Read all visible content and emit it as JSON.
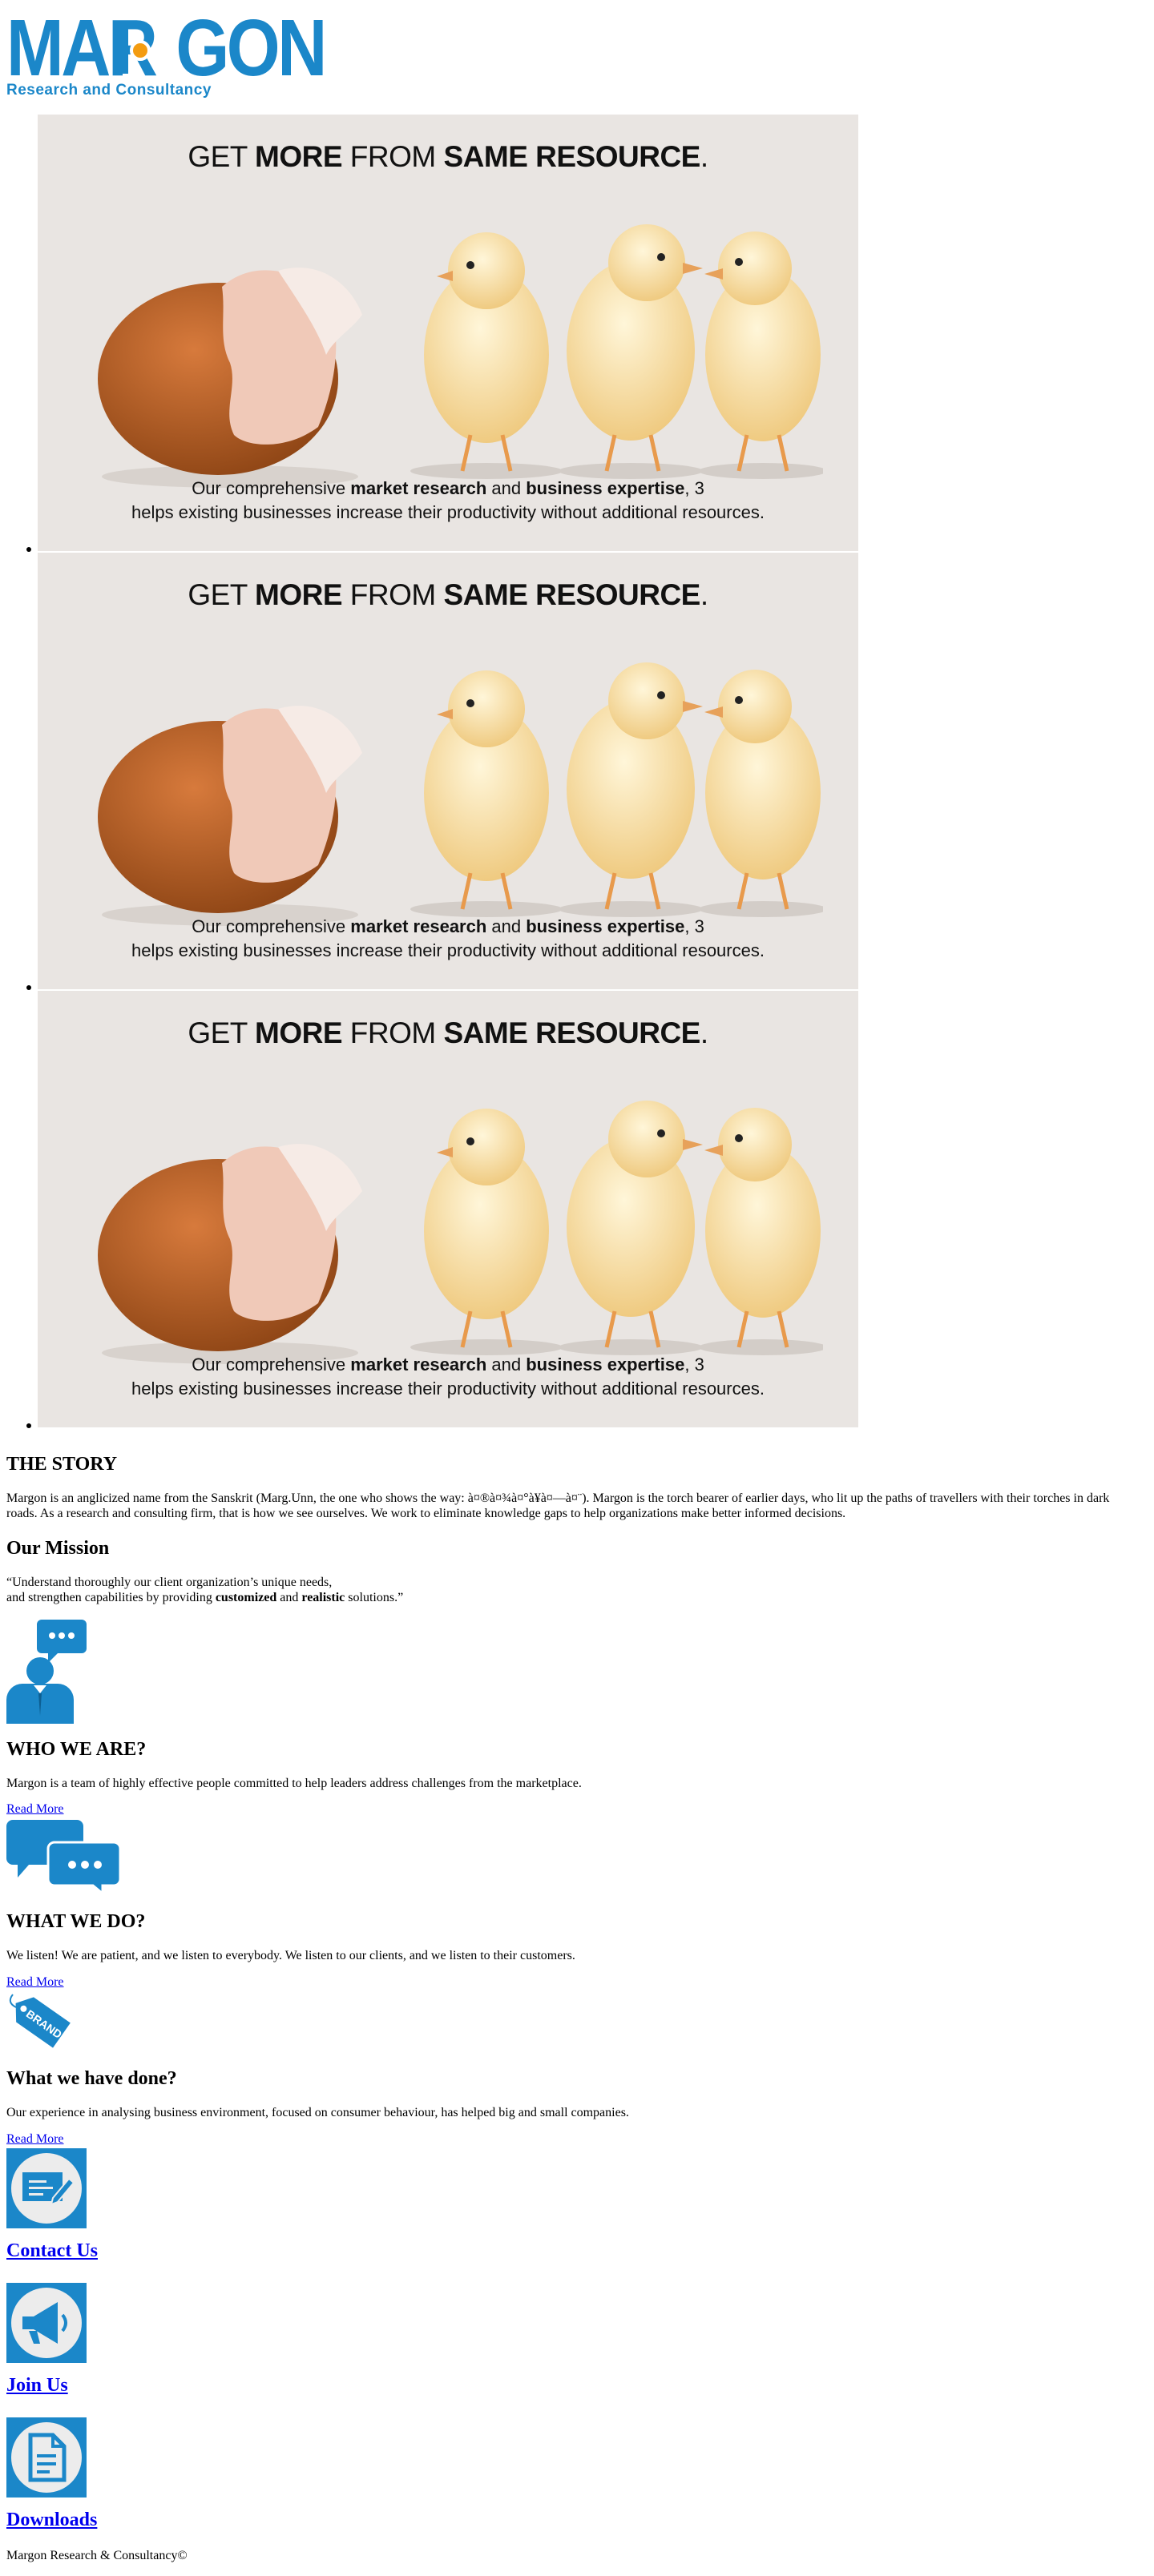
{
  "logo": {
    "word_part1": "MAR",
    "word_part2": "GON",
    "tagline": "Research and Consultancy",
    "brand_color": "#1b87c9",
    "accent_color": "#f39c12"
  },
  "slider": {
    "slides": [
      {
        "title_pre": "GET ",
        "title_b1": "MORE",
        "title_mid": " FROM ",
        "title_b2": "SAME RESOURCE",
        "title_post": ".",
        "cap_pre": "Our comprehensive ",
        "cap_b1": "market research",
        "cap_mid": " and ",
        "cap_b2": "business expertise",
        "cap_post": ", 3",
        "cap_line2": "helps existing businesses increase their productivity without additional resources."
      },
      {
        "title_pre": "GET ",
        "title_b1": "MORE",
        "title_mid": " FROM ",
        "title_b2": "SAME RESOURCE",
        "title_post": ".",
        "cap_pre": "Our comprehensive ",
        "cap_b1": "market research",
        "cap_mid": " and ",
        "cap_b2": "business expertise",
        "cap_post": ", 3",
        "cap_line2": "helps existing businesses increase their productivity without additional resources."
      },
      {
        "title_pre": "GET ",
        "title_b1": "MORE",
        "title_mid": " FROM ",
        "title_b2": "SAME RESOURCE",
        "title_post": ".",
        "cap_pre": "Our comprehensive ",
        "cap_b1": "market research",
        "cap_mid": " and ",
        "cap_b2": "business expertise",
        "cap_post": ", 3",
        "cap_line2": "helps existing businesses increase their productivity without additional resources."
      }
    ]
  },
  "story": {
    "heading": "THE STORY",
    "text": "Margon is an anglicized name from the Sanskrit (Marg.Unn, the one who shows the way: à¤®à¤¾à¤°à¥à¤—à¤¨). Margon is the torch bearer of earlier days, who lit up the paths of travellers with their torches in dark roads. As a research and consulting firm, that is how we see ourselves. We work to eliminate knowledge gaps to help organizations make better informed decisions."
  },
  "mission": {
    "heading": "Our Mission",
    "line1": "“Understand thoroughly our client organization’s unique needs,",
    "line2_pre": "and strengthen capabilities by providing ",
    "line2_b1": "customized",
    "line2_mid": " and ",
    "line2_b2": "realistic",
    "line2_post": " solutions.”"
  },
  "who": {
    "heading": "WHO WE ARE?",
    "text": "Margon is a team of highly effective people committed to help leaders address challenges from the marketplace.",
    "link": "Read More"
  },
  "what": {
    "heading": "WHAT WE DO?",
    "text": "We listen! We are patient, and we listen to everybody. We listen to our clients, and we listen to their customers.",
    "link": "Read More"
  },
  "done": {
    "heading": "What we have done?",
    "brand_tag": "BRAND",
    "text": "Our experience in analysing business environment, focused on consumer behaviour, has helped big and small companies.",
    "link": "Read More"
  },
  "contact": {
    "heading": "Contact Us"
  },
  "join": {
    "heading": "Join Us"
  },
  "downloads": {
    "heading": "Downloads"
  },
  "footer": {
    "text": "Margon Research & Consultancy©"
  }
}
